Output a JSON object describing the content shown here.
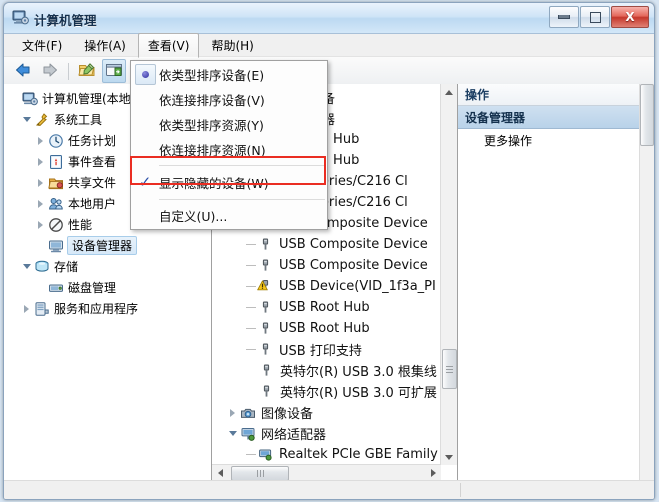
{
  "window": {
    "title": "计算机管理",
    "icon": "computer-management-icon",
    "buttons": {
      "minimize": "最小化",
      "maximize": "最大化",
      "close": "关闭",
      "close_glyph": "X"
    }
  },
  "menubar": {
    "items": [
      {
        "label": "文件(F)",
        "active": false
      },
      {
        "label": "操作(A)",
        "active": false
      },
      {
        "label": "查看(V)",
        "active": true
      },
      {
        "label": "帮助(H)",
        "active": false
      }
    ]
  },
  "toolbar": {
    "buttons": [
      {
        "name": "back-button",
        "icon": "back-arrow-icon"
      },
      {
        "name": "forward-button",
        "icon": "forward-arrow-icon"
      },
      {
        "name": "properties-button",
        "icon": "properties-icon"
      },
      {
        "name": "show-hide-console-tree-button",
        "icon": "console-panel-icon"
      }
    ]
  },
  "view_menu": {
    "items": [
      {
        "label": "依类型排序设备(E)",
        "accel": "E",
        "marker": "radio-selected"
      },
      {
        "label": "依连接排序设备(V)",
        "accel": "V",
        "marker": "none"
      },
      {
        "label": "依类型排序资源(Y)",
        "accel": "Y",
        "marker": "none"
      },
      {
        "label": "依连接排序资源(N)",
        "accel": "N",
        "marker": "none"
      },
      {
        "label": "显示隐藏的设备(W)",
        "accel": "W",
        "marker": "checked",
        "highlighted": true
      },
      {
        "label": "自定义(U)...",
        "accel": "U",
        "marker": "none"
      }
    ]
  },
  "tree": {
    "items": [
      {
        "label": "计算机管理(本地",
        "indent": 0,
        "toggle": "none",
        "icon": "computer-management-icon",
        "selected": false
      },
      {
        "label": "系统工具",
        "indent": 1,
        "toggle": "expanded",
        "icon": "system-tools-icon",
        "selected": false
      },
      {
        "label": "任务计划",
        "indent": 2,
        "toggle": "collapsed",
        "icon": "task-scheduler-icon",
        "selected": false
      },
      {
        "label": "事件查看",
        "indent": 2,
        "toggle": "collapsed",
        "icon": "event-viewer-icon",
        "selected": false
      },
      {
        "label": "共享文件",
        "indent": 2,
        "toggle": "collapsed",
        "icon": "shared-folders-icon",
        "selected": false
      },
      {
        "label": "本地用户",
        "indent": 2,
        "toggle": "collapsed",
        "icon": "local-users-icon",
        "selected": false
      },
      {
        "label": "性能",
        "indent": 2,
        "toggle": "collapsed",
        "icon": "performance-icon",
        "selected": false
      },
      {
        "label": "设备管理器",
        "indent": 2,
        "toggle": "none",
        "icon": "device-manager-icon",
        "selected": true
      },
      {
        "label": "存储",
        "indent": 1,
        "toggle": "expanded",
        "icon": "storage-icon",
        "selected": false
      },
      {
        "label": "磁盘管理",
        "indent": 2,
        "toggle": "none",
        "icon": "disk-management-icon",
        "selected": false
      },
      {
        "label": "服务和应用程序",
        "indent": 1,
        "toggle": "collapsed",
        "icon": "services-apps-icon",
        "selected": false
      }
    ]
  },
  "devices": {
    "items": [
      {
        "label": "他指针设备",
        "indent": 1,
        "toggle": "none",
        "icon": "mouse-icon",
        "connector": false,
        "warning": false
      },
      {
        "label": "总线控制器",
        "indent": 1,
        "toggle": "none",
        "icon": "usb-controller-icon",
        "connector": false,
        "warning": false
      },
      {
        "label": "ric USB Hub",
        "indent": 2,
        "toggle": "none",
        "icon": "usb-icon",
        "connector": false,
        "warning": false
      },
      {
        "label": "ric USB Hub",
        "indent": 2,
        "toggle": "none",
        "icon": "usb-icon",
        "connector": false,
        "warning": false
      },
      {
        "label": "R) 7 Series/C216 Cl",
        "indent": 2,
        "toggle": "none",
        "icon": "usb-icon",
        "connector": false,
        "warning": false
      },
      {
        "label": "R) 7 Series/C216 Cl",
        "indent": 2,
        "toggle": "none",
        "icon": "usb-icon",
        "connector": false,
        "warning": false
      },
      {
        "label": "USB Composite Device",
        "indent": 2,
        "toggle": "none",
        "icon": "usb-icon",
        "connector": true,
        "warning": false
      },
      {
        "label": "USB Composite Device",
        "indent": 2,
        "toggle": "none",
        "icon": "usb-icon",
        "connector": true,
        "warning": false
      },
      {
        "label": "USB Composite Device",
        "indent": 2,
        "toggle": "none",
        "icon": "usb-icon",
        "connector": true,
        "warning": false
      },
      {
        "label": "USB Device(VID_1f3a_PI",
        "indent": 2,
        "toggle": "none",
        "icon": "usb-icon",
        "connector": true,
        "warning": true
      },
      {
        "label": "USB Root Hub",
        "indent": 2,
        "toggle": "none",
        "icon": "usb-icon",
        "connector": true,
        "warning": false
      },
      {
        "label": "USB Root Hub",
        "indent": 2,
        "toggle": "none",
        "icon": "usb-icon",
        "connector": true,
        "warning": false
      },
      {
        "label": "USB 打印支持",
        "indent": 2,
        "toggle": "none",
        "icon": "usb-icon",
        "connector": true,
        "warning": false
      },
      {
        "label": "英特尔(R) USB 3.0 根集线",
        "indent": 2,
        "toggle": "none",
        "icon": "usb-icon",
        "connector": false,
        "warning": false
      },
      {
        "label": "英特尔(R) USB 3.0 可扩展",
        "indent": 2,
        "toggle": "none",
        "icon": "usb-icon",
        "connector": false,
        "warning": false
      },
      {
        "label": "图像设备",
        "indent": 1,
        "toggle": "collapsed",
        "icon": "imaging-device-icon",
        "connector": false,
        "warning": false
      },
      {
        "label": "网络适配器",
        "indent": 1,
        "toggle": "expanded",
        "icon": "network-adapter-icon",
        "connector": false,
        "warning": false
      },
      {
        "label": "Realtek PCIe GBE Family",
        "indent": 2,
        "toggle": "none",
        "icon": "network-card-icon",
        "connector": true,
        "warning": false
      }
    ]
  },
  "actions": {
    "header": "操作",
    "group": "设备管理器",
    "items": [
      {
        "label": "更多操作",
        "submenu": true
      }
    ]
  }
}
